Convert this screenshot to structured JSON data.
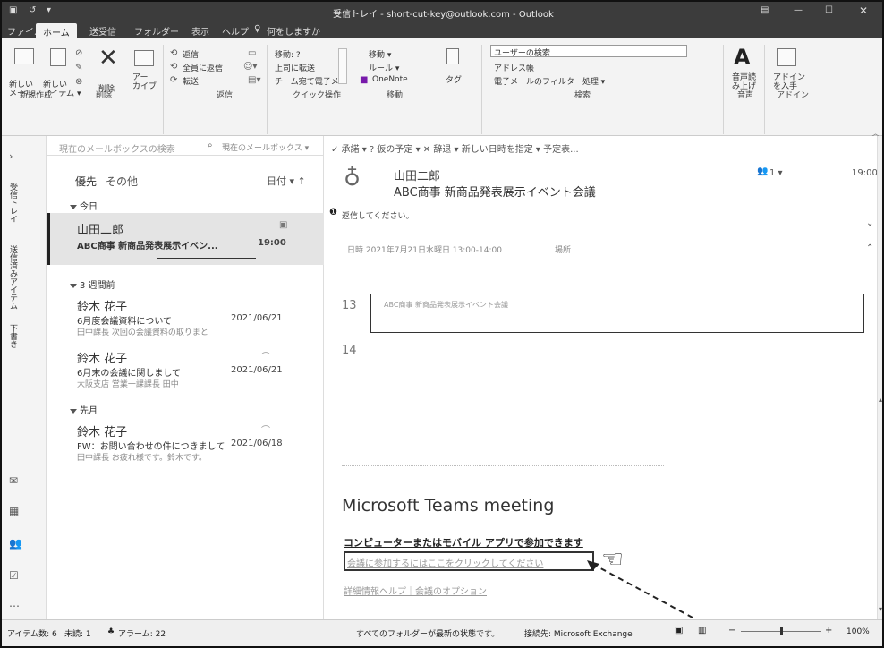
{
  "window": {
    "title": "受信トレイ - short-cut-key@outlook.com - Outlook"
  },
  "tabs": [
    "ファイル",
    "ホーム",
    "送受信",
    "フォルダー",
    "表示",
    "ヘルプ"
  ],
  "tell_me": "何をしますか",
  "ribbon": {
    "new_mail": "新しい\nメール",
    "new_items": "新しい\nアイテム ▾",
    "delete": "削除",
    "archive": "アー\nカイブ",
    "reply": "返信",
    "reply_all": "全員に返信",
    "forward": "転送",
    "qs1": "移動: ?",
    "qs2": "上司に転送",
    "qs3": "チーム宛て電子メ",
    "move": "移動 ▾",
    "rules": "ルール ▾",
    "onenote": "OneNote",
    "tags": "タグ",
    "search_people": "ユーザーの検索",
    "address_book": "アドレス帳",
    "filter_email": "電子メールのフィルター処理 ▾",
    "read_aloud": "音声読\nみ上げ",
    "addins": "アドイン\nを入手",
    "groups": [
      "新規作成",
      "削除",
      "返信",
      "クイック操作",
      "移動",
      "検索",
      "音声",
      "アドイン"
    ]
  },
  "search": {
    "placeholder": "現在のメールボックスの検索",
    "scope": "現在のメールボックス ▾"
  },
  "filters": {
    "focused": "優先",
    "other": "その他",
    "sort": "日付 ▾ ↑"
  },
  "nav_labels": [
    "受信トレイ",
    "送信済みアイテム",
    "下書き"
  ],
  "list": {
    "groups": [
      "今日",
      "3 週間前",
      "先月"
    ],
    "items": [
      {
        "sender": "山田二郎",
        "subject": "ABC商事 新商品発表展示イベン...",
        "date": "19:00",
        "preview": ""
      },
      {
        "sender": "鈴木 花子",
        "subject": "6月度会議資料について",
        "date": "2021/06/21",
        "preview": "田中課長 次回の会議資料の取りまと"
      },
      {
        "sender": "鈴木 花子",
        "subject": "6月末の会議に関しまして",
        "date": "2021/06/21",
        "preview": "大阪支店 営業一課課長 田中"
      },
      {
        "sender": "鈴木 花子",
        "subject": "FW：お問い合わせの件につきまして",
        "date": "2021/06/18",
        "preview": "田中課長 お疲れ様です。鈴木です。"
      }
    ]
  },
  "reading": {
    "actions": "✓ 承諾 ▾  ? 仮の予定 ▾  ✕ 辞退 ▾  新しい日時を指定 ▾  予定表...",
    "sender": "山田二郎",
    "subject": "ABC商事 新商品発表展示イベント会議",
    "attendees": "1 ▾",
    "time": "19:00",
    "notice": "返信してください。",
    "meeting_time": "日時 2021年7月21日水曜日 13:00-14:00",
    "location": "場所",
    "line13": "13",
    "line14": "14",
    "quote": "ABC商事 新商品発表展示イベント会議",
    "teams_title": "Microsoft Teams meeting",
    "join_heading": "コンピューターまたはモバイル アプリで参加できます",
    "join_link": "会議に参加するにはここをクリックしてください",
    "more_info": "詳細情報ヘルプ｜会議のオプション"
  },
  "status": {
    "items": "アイテム数: 6",
    "unread": "未読: 1",
    "alarm": "アラーム: 22",
    "sync": "すべてのフォルダーが最新の状態です。",
    "connect": "接続先: Microsoft Exchange",
    "zoom": "100%"
  }
}
